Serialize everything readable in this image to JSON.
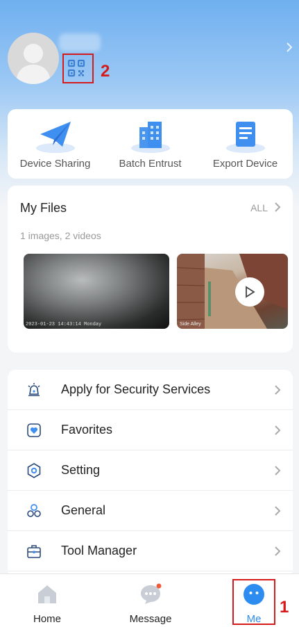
{
  "profile": {},
  "quick_actions": [
    {
      "label": "Device Sharing",
      "icon": "paper-plane-icon"
    },
    {
      "label": "Batch Entrust",
      "icon": "buildings-icon"
    },
    {
      "label": "Export Device",
      "icon": "document-list-icon"
    }
  ],
  "files": {
    "title": "My Files",
    "all_label": "ALL",
    "count_text": "1 images, 2 videos",
    "thumbnails": [
      {
        "type": "image",
        "timestamp": "2023-01-23 14:43:14 Monday"
      },
      {
        "type": "video",
        "timestamp": "Side Alley"
      }
    ]
  },
  "menu": [
    {
      "label": "Apply for Security Services",
      "icon": "alarm-siren-icon"
    },
    {
      "label": "Favorites",
      "icon": "heart-shield-icon"
    },
    {
      "label": "Setting",
      "icon": "hexagon-gear-icon"
    },
    {
      "label": "General",
      "icon": "three-circles-icon"
    },
    {
      "label": "Tool Manager",
      "icon": "toolbox-icon"
    }
  ],
  "tabs": [
    {
      "label": "Home",
      "icon": "home-icon",
      "active": false
    },
    {
      "label": "Message",
      "icon": "chat-bubble-icon",
      "active": false,
      "badge": true
    },
    {
      "label": "Me",
      "icon": "me-face-icon",
      "active": true
    }
  ],
  "annotations": [
    {
      "label": "1"
    },
    {
      "label": "2"
    }
  ],
  "colors": {
    "accent": "#2d8cf0",
    "highlight": "#d51a1a",
    "badge": "#f25a3c"
  }
}
